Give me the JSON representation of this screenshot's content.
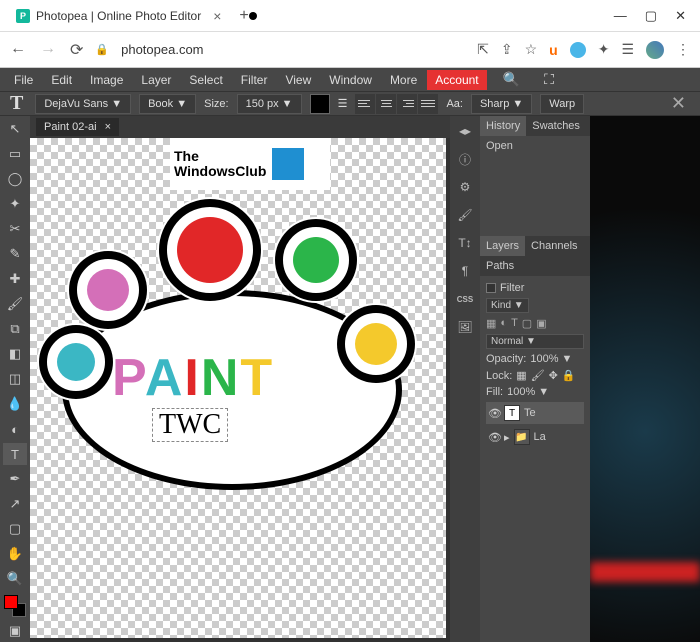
{
  "browser": {
    "tab_title": "Photopea | Online Photo Editor",
    "favicon_letter": "P",
    "url": "photopea.com",
    "ublock_label": "u"
  },
  "menu": {
    "items": [
      "File",
      "Edit",
      "Image",
      "Layer",
      "Select",
      "Filter",
      "View",
      "Window",
      "More"
    ],
    "account": "Account"
  },
  "options": {
    "font_family": "DejaVu Sans ▼",
    "font_weight": "Book ▼",
    "size_label": "Size:",
    "size_value": "150 px ▼",
    "aa_label": "Aa:",
    "aa_value": "Sharp ▼",
    "warp": "Warp"
  },
  "document": {
    "tab_name": "Paint 02-ai",
    "logo_line1": "The",
    "logo_line2": "WindowsClub",
    "paint_letters": [
      "P",
      "A",
      "I",
      "N",
      "T"
    ],
    "editing_text": "TWC"
  },
  "panels": {
    "history": {
      "tab1": "History",
      "tab2": "Swatches",
      "entry": "Open"
    },
    "layers": {
      "tabs": [
        "Layers",
        "Channels",
        "Paths"
      ],
      "filter_label": "Filter",
      "kind_label": "Kind ▼",
      "blend_mode": "Normal ▼",
      "opacity_label": "Opacity:",
      "opacity_value": "100% ▼",
      "lock_label": "Lock:",
      "fill_label": "Fill:",
      "fill_value": "100% ▼",
      "items": [
        {
          "name": "Te",
          "thumb": "T"
        },
        {
          "name": "La",
          "thumb": "📁"
        }
      ]
    }
  },
  "strip_css": "CSS"
}
